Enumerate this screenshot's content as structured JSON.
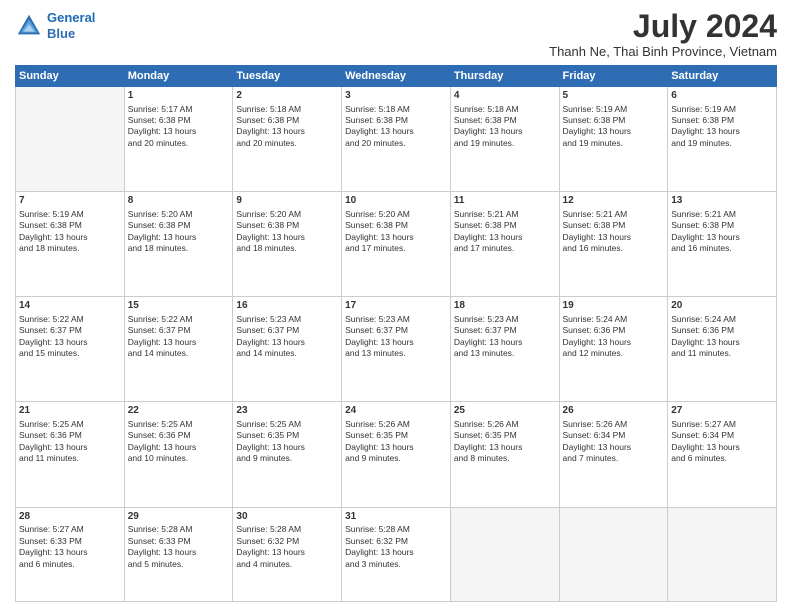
{
  "logo": {
    "line1": "General",
    "line2": "Blue"
  },
  "title": "July 2024",
  "location": "Thanh Ne, Thai Binh Province, Vietnam",
  "days_header": [
    "Sunday",
    "Monday",
    "Tuesday",
    "Wednesday",
    "Thursday",
    "Friday",
    "Saturday"
  ],
  "weeks": [
    [
      {
        "day": "",
        "content": ""
      },
      {
        "day": "1",
        "content": "Sunrise: 5:17 AM\nSunset: 6:38 PM\nDaylight: 13 hours\nand 20 minutes."
      },
      {
        "day": "2",
        "content": "Sunrise: 5:18 AM\nSunset: 6:38 PM\nDaylight: 13 hours\nand 20 minutes."
      },
      {
        "day": "3",
        "content": "Sunrise: 5:18 AM\nSunset: 6:38 PM\nDaylight: 13 hours\nand 20 minutes."
      },
      {
        "day": "4",
        "content": "Sunrise: 5:18 AM\nSunset: 6:38 PM\nDaylight: 13 hours\nand 19 minutes."
      },
      {
        "day": "5",
        "content": "Sunrise: 5:19 AM\nSunset: 6:38 PM\nDaylight: 13 hours\nand 19 minutes."
      },
      {
        "day": "6",
        "content": "Sunrise: 5:19 AM\nSunset: 6:38 PM\nDaylight: 13 hours\nand 19 minutes."
      }
    ],
    [
      {
        "day": "7",
        "content": "Sunrise: 5:19 AM\nSunset: 6:38 PM\nDaylight: 13 hours\nand 18 minutes."
      },
      {
        "day": "8",
        "content": "Sunrise: 5:20 AM\nSunset: 6:38 PM\nDaylight: 13 hours\nand 18 minutes."
      },
      {
        "day": "9",
        "content": "Sunrise: 5:20 AM\nSunset: 6:38 PM\nDaylight: 13 hours\nand 18 minutes."
      },
      {
        "day": "10",
        "content": "Sunrise: 5:20 AM\nSunset: 6:38 PM\nDaylight: 13 hours\nand 17 minutes."
      },
      {
        "day": "11",
        "content": "Sunrise: 5:21 AM\nSunset: 6:38 PM\nDaylight: 13 hours\nand 17 minutes."
      },
      {
        "day": "12",
        "content": "Sunrise: 5:21 AM\nSunset: 6:38 PM\nDaylight: 13 hours\nand 16 minutes."
      },
      {
        "day": "13",
        "content": "Sunrise: 5:21 AM\nSunset: 6:38 PM\nDaylight: 13 hours\nand 16 minutes."
      }
    ],
    [
      {
        "day": "14",
        "content": "Sunrise: 5:22 AM\nSunset: 6:37 PM\nDaylight: 13 hours\nand 15 minutes."
      },
      {
        "day": "15",
        "content": "Sunrise: 5:22 AM\nSunset: 6:37 PM\nDaylight: 13 hours\nand 14 minutes."
      },
      {
        "day": "16",
        "content": "Sunrise: 5:23 AM\nSunset: 6:37 PM\nDaylight: 13 hours\nand 14 minutes."
      },
      {
        "day": "17",
        "content": "Sunrise: 5:23 AM\nSunset: 6:37 PM\nDaylight: 13 hours\nand 13 minutes."
      },
      {
        "day": "18",
        "content": "Sunrise: 5:23 AM\nSunset: 6:37 PM\nDaylight: 13 hours\nand 13 minutes."
      },
      {
        "day": "19",
        "content": "Sunrise: 5:24 AM\nSunset: 6:36 PM\nDaylight: 13 hours\nand 12 minutes."
      },
      {
        "day": "20",
        "content": "Sunrise: 5:24 AM\nSunset: 6:36 PM\nDaylight: 13 hours\nand 11 minutes."
      }
    ],
    [
      {
        "day": "21",
        "content": "Sunrise: 5:25 AM\nSunset: 6:36 PM\nDaylight: 13 hours\nand 11 minutes."
      },
      {
        "day": "22",
        "content": "Sunrise: 5:25 AM\nSunset: 6:36 PM\nDaylight: 13 hours\nand 10 minutes."
      },
      {
        "day": "23",
        "content": "Sunrise: 5:25 AM\nSunset: 6:35 PM\nDaylight: 13 hours\nand 9 minutes."
      },
      {
        "day": "24",
        "content": "Sunrise: 5:26 AM\nSunset: 6:35 PM\nDaylight: 13 hours\nand 9 minutes."
      },
      {
        "day": "25",
        "content": "Sunrise: 5:26 AM\nSunset: 6:35 PM\nDaylight: 13 hours\nand 8 minutes."
      },
      {
        "day": "26",
        "content": "Sunrise: 5:26 AM\nSunset: 6:34 PM\nDaylight: 13 hours\nand 7 minutes."
      },
      {
        "day": "27",
        "content": "Sunrise: 5:27 AM\nSunset: 6:34 PM\nDaylight: 13 hours\nand 6 minutes."
      }
    ],
    [
      {
        "day": "28",
        "content": "Sunrise: 5:27 AM\nSunset: 6:33 PM\nDaylight: 13 hours\nand 6 minutes."
      },
      {
        "day": "29",
        "content": "Sunrise: 5:28 AM\nSunset: 6:33 PM\nDaylight: 13 hours\nand 5 minutes."
      },
      {
        "day": "30",
        "content": "Sunrise: 5:28 AM\nSunset: 6:32 PM\nDaylight: 13 hours\nand 4 minutes."
      },
      {
        "day": "31",
        "content": "Sunrise: 5:28 AM\nSunset: 6:32 PM\nDaylight: 13 hours\nand 3 minutes."
      },
      {
        "day": "",
        "content": ""
      },
      {
        "day": "",
        "content": ""
      },
      {
        "day": "",
        "content": ""
      }
    ]
  ]
}
